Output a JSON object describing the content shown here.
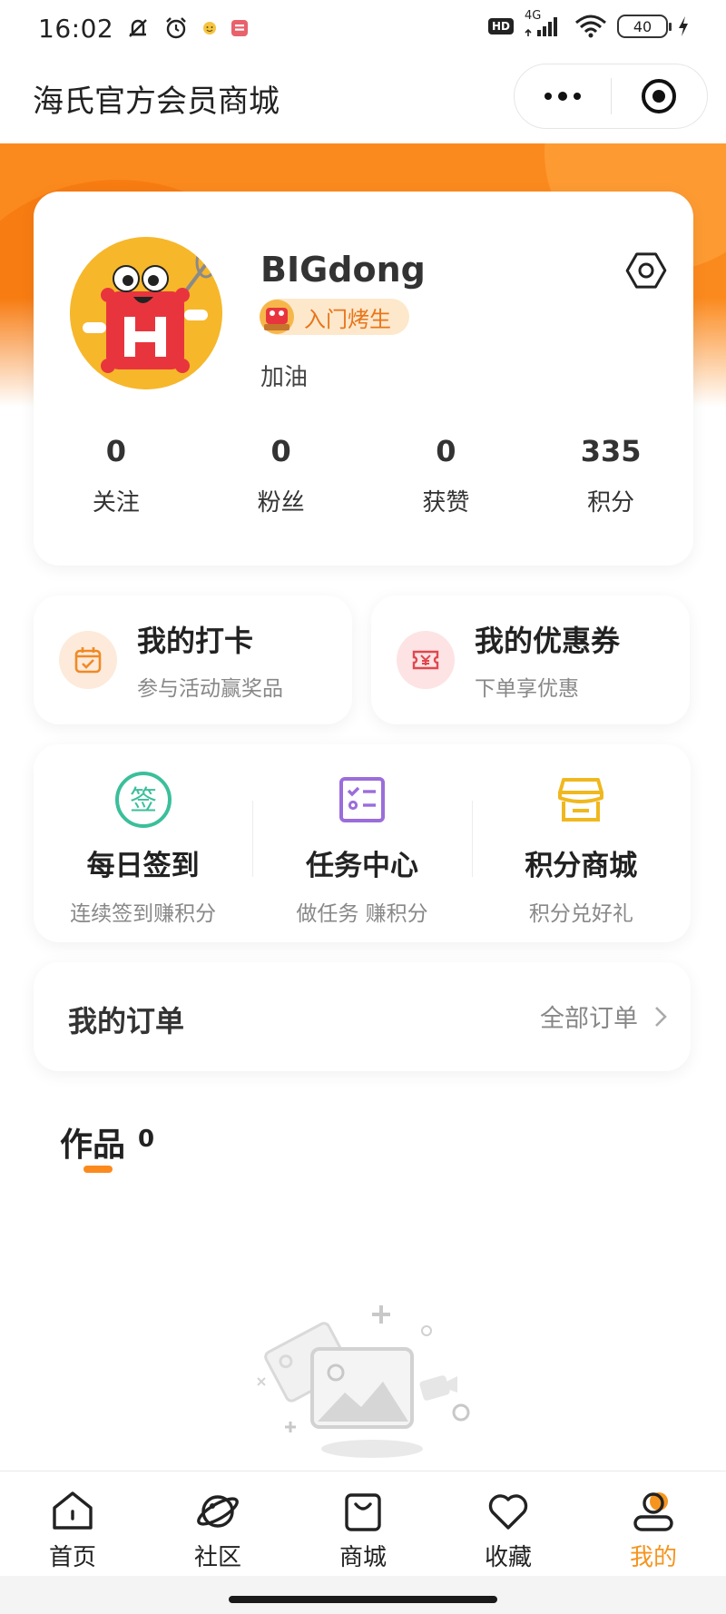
{
  "status_bar": {
    "time": "16:02",
    "network": "4G",
    "battery": "40",
    "hd_label": "HD"
  },
  "header": {
    "title": "海氏官方会员商城"
  },
  "profile": {
    "username": "BIGdong",
    "level": "入门烤生",
    "bio": "加油",
    "stats": [
      {
        "value": "0",
        "label": "关注"
      },
      {
        "value": "0",
        "label": "粉丝"
      },
      {
        "value": "0",
        "label": "获赞"
      },
      {
        "value": "335",
        "label": "积分"
      }
    ]
  },
  "shortcuts": [
    {
      "title": "我的打卡",
      "subtitle": "参与活动赢奖品",
      "icon": "calendar-check-icon"
    },
    {
      "title": "我的优惠券",
      "subtitle": "下单享优惠",
      "icon": "coupon-icon"
    }
  ],
  "features": [
    {
      "title": "每日签到",
      "subtitle": "连续签到赚积分",
      "icon": "sign-in-icon",
      "icon_text": "签",
      "color": "#3bbf9a"
    },
    {
      "title": "任务中心",
      "subtitle": "做任务 赚积分",
      "icon": "task-list-icon",
      "color": "#9b6ddb"
    },
    {
      "title": "积分商城",
      "subtitle": "积分兑好礼",
      "icon": "store-icon",
      "color": "#f0b81f"
    }
  ],
  "orders": {
    "title": "我的订单",
    "link": "全部订单"
  },
  "works": {
    "title": "作品",
    "count": "0"
  },
  "tab_bar": [
    {
      "label": "首页",
      "icon": "home-icon"
    },
    {
      "label": "社区",
      "icon": "planet-icon"
    },
    {
      "label": "商城",
      "icon": "shopping-bag-icon"
    },
    {
      "label": "收藏",
      "icon": "heart-icon"
    },
    {
      "label": "我的",
      "icon": "user-icon",
      "active": true
    }
  ],
  "colors": {
    "accent": "#fb8a1e",
    "active_tab": "#f5951f",
    "level_text": "#e8751a"
  }
}
